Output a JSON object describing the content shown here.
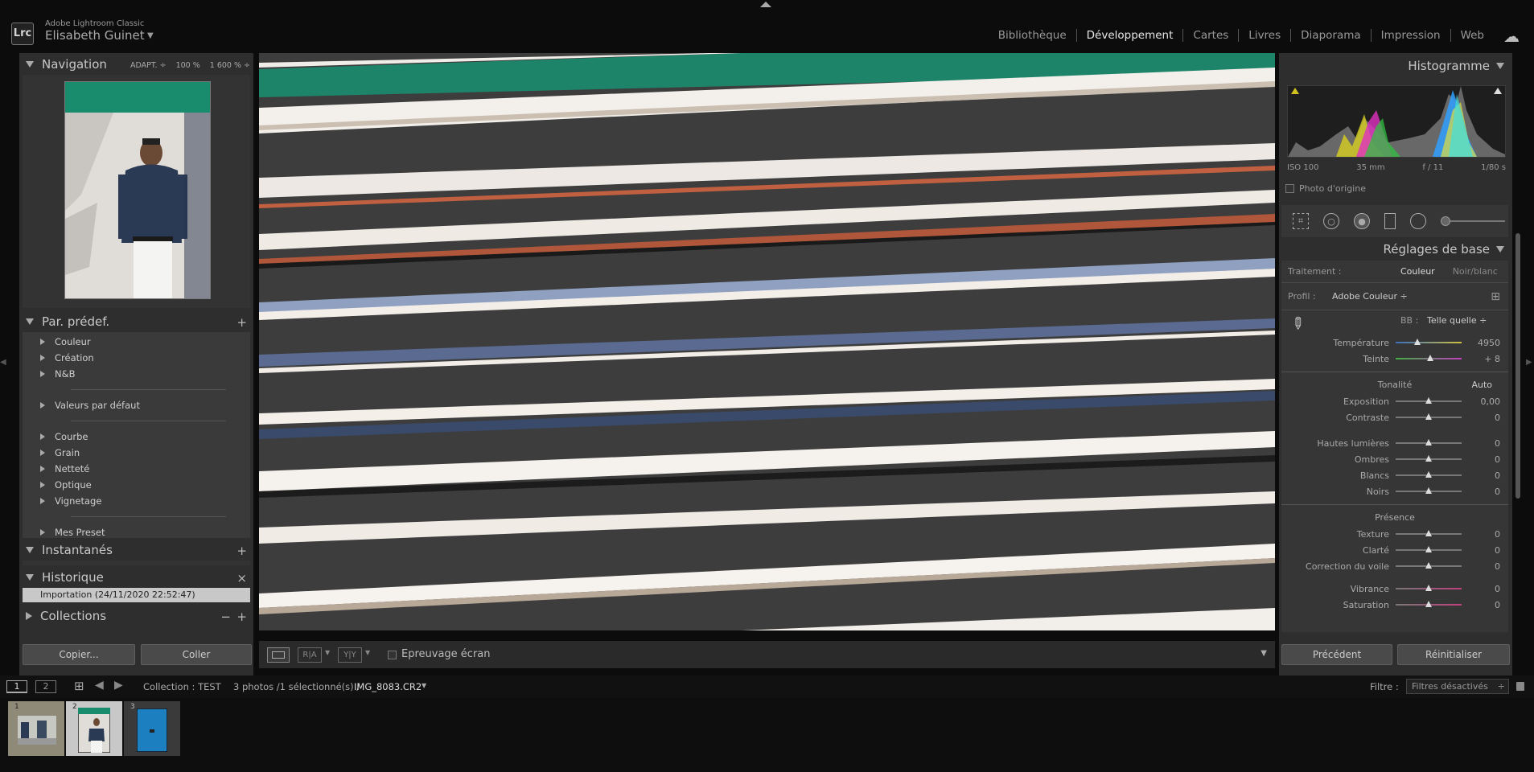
{
  "app": {
    "product": "Adobe Lightroom Classic",
    "logo": "Lrc",
    "user": "Elisabeth Guinet"
  },
  "modules": [
    "Bibliothèque",
    "Développement",
    "Cartes",
    "Livres",
    "Diaporama",
    "Impression",
    "Web"
  ],
  "active_module": "Développement",
  "left": {
    "navigation": {
      "title": "Navigation",
      "fit": "ADAPT. ÷",
      "zoom1": "100 %",
      "zoom2": "1 600 % ÷"
    },
    "presets": {
      "title": "Par. prédef.",
      "groups": [
        [
          "Couleur",
          "Création",
          "N&B"
        ],
        [
          "Valeurs par défaut"
        ],
        [
          "Courbe",
          "Grain",
          "Netteté",
          "Optique",
          "Vignetage"
        ],
        [
          "Mes Preset"
        ]
      ]
    },
    "snapshots": {
      "title": "Instantanés"
    },
    "history": {
      "title": "Historique",
      "items": [
        "Importation (24/11/2020 22:52:47)"
      ]
    },
    "collections": {
      "title": "Collections"
    },
    "copy": "Copier...",
    "paste": "Coller"
  },
  "toolbar": {
    "soft_proof": "Epreuvage écran"
  },
  "right": {
    "histogram": {
      "title": "Histogramme",
      "iso": "ISO 100",
      "focal": "35 mm",
      "aperture": "f / 11",
      "shutter": "1/80 s",
      "original": "Photo d'origine"
    },
    "basic": {
      "title": "Réglages de base",
      "treatment_label": "Traitement :",
      "treatment_color": "Couleur",
      "treatment_bw": "Noir/blanc",
      "profile_label": "Profil :",
      "profile_value": "Adobe Couleur ÷",
      "wb_label": "BB :",
      "wb_value": "Telle quelle ÷",
      "wb_sliders": [
        {
          "label": "Température",
          "value": "4950",
          "pos": 0.33
        },
        {
          "label": "Teinte",
          "value": "+ 8",
          "pos": 0.52
        }
      ],
      "tone_title": "Tonalité",
      "auto": "Auto",
      "tone_sliders": [
        {
          "label": "Exposition",
          "value": "0,00",
          "pos": 0.5
        },
        {
          "label": "Contraste",
          "value": "0",
          "pos": 0.5
        }
      ],
      "tone2_sliders": [
        {
          "label": "Hautes lumières",
          "value": "0",
          "pos": 0.5
        },
        {
          "label": "Ombres",
          "value": "0",
          "pos": 0.5
        },
        {
          "label": "Blancs",
          "value": "0",
          "pos": 0.5
        },
        {
          "label": "Noirs",
          "value": "0",
          "pos": 0.5
        }
      ],
      "presence_title": "Présence",
      "presence_sliders": [
        {
          "label": "Texture",
          "value": "0",
          "pos": 0.5
        },
        {
          "label": "Clarté",
          "value": "0",
          "pos": 0.5
        },
        {
          "label": "Correction du voile",
          "value": "0",
          "pos": 0.5
        }
      ],
      "presence2_sliders": [
        {
          "label": "Vibrance",
          "value": "0",
          "pos": 0.5
        },
        {
          "label": "Saturation",
          "value": "0",
          "pos": 0.5
        }
      ]
    },
    "previous": "Précédent",
    "reset": "Réinitialiser"
  },
  "filmbar": {
    "screen1": "1",
    "screen2": "2",
    "collection": "Collection : TEST",
    "count": "3 photos /1 sélectionné(s) /",
    "filename": "IMG_8083.CR2",
    "filter_label": "Filtre :",
    "filter_value": "Filtres désactivés"
  },
  "filmstrip": {
    "numbers": [
      "1",
      "2",
      "3"
    ]
  }
}
